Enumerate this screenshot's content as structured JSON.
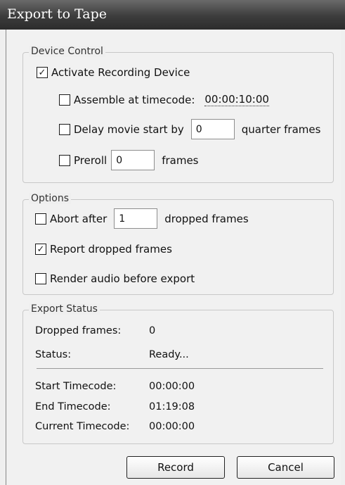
{
  "window": {
    "title": "Export to Tape"
  },
  "device_control": {
    "legend": "Device Control",
    "activate_label": "Activate Recording Device",
    "activate_checked": true,
    "assemble_label": "Assemble at timecode:",
    "assemble_checked": false,
    "assemble_timecode": "00:00:10:00",
    "delay_label": "Delay movie start by",
    "delay_checked": false,
    "delay_value": "0",
    "delay_unit": "quarter frames",
    "preroll_label": "Preroll",
    "preroll_checked": false,
    "preroll_value": "0",
    "preroll_unit": "frames"
  },
  "options": {
    "legend": "Options",
    "abort_label": "Abort after",
    "abort_checked": false,
    "abort_value": "1",
    "abort_unit": "dropped frames",
    "report_label": "Report dropped frames",
    "report_checked": true,
    "render_label": "Render audio before export",
    "render_checked": false
  },
  "export_status": {
    "legend": "Export Status",
    "dropped_label": "Dropped frames:",
    "dropped_value": "0",
    "status_label": "Status:",
    "status_value": "Ready...",
    "start_label": "Start Timecode:",
    "start_value": "00:00:00",
    "end_label": "End Timecode:",
    "end_value": "01:19:08",
    "current_label": "Current Timecode:",
    "current_value": "00:00:00"
  },
  "buttons": {
    "record": "Record",
    "cancel": "Cancel"
  }
}
